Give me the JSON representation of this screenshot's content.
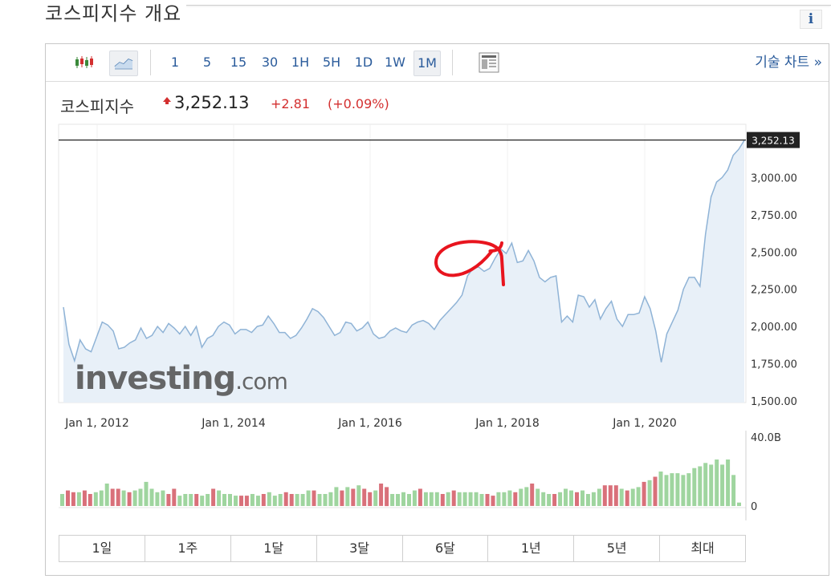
{
  "page": {
    "section_title": "코스피지수 개요",
    "info_icon_label": "i"
  },
  "toolbar": {
    "chart_types": [
      {
        "name": "candlestick-icon",
        "active": false
      },
      {
        "name": "line-chart-icon",
        "active": true
      }
    ],
    "intervals": [
      "1",
      "5",
      "15",
      "30",
      "1H",
      "5H",
      "1D",
      "1W",
      "1M"
    ],
    "active_interval": "1M",
    "technical_chart_link": "기술 차트 »"
  },
  "quote": {
    "name": "코스피지수",
    "price": "3,252.13",
    "change": "+2.81",
    "change_pct": "(+0.09%)",
    "up_color": "#d32f2f"
  },
  "chart_data": {
    "type": "line",
    "title": "",
    "xlabel": "",
    "ylabel": "",
    "x_tick_labels": [
      "Jan 1, 2012",
      "Jan 1, 2014",
      "Jan 1, 2016",
      "Jan 1, 2018",
      "Jan 1, 2020"
    ],
    "x_range": [
      "2011-06",
      "2021-06"
    ],
    "y_tick_labels": [
      "1,500.00",
      "1,750.00",
      "2,000.00",
      "2,250.00",
      "2,500.00",
      "2,750.00",
      "3,000.00"
    ],
    "ylim": [
      1500,
      3250
    ],
    "last_price_label": "3,252.13",
    "last_price": 3252.13,
    "watermark": "investing.com",
    "series": [
      {
        "values": [
          2130,
          1880,
          1770,
          1910,
          1850,
          1830,
          1930,
          2030,
          2010,
          1970,
          1850,
          1860,
          1890,
          1910,
          1990,
          1920,
          1940,
          2000,
          1960,
          2020,
          1990,
          1950,
          2000,
          1940,
          2000,
          1860,
          1920,
          1940,
          2000,
          2030,
          2010,
          1950,
          1980,
          1980,
          1960,
          2000,
          2010,
          2070,
          2020,
          1960,
          1960,
          1920,
          1940,
          1990,
          2050,
          2120,
          2100,
          2060,
          2000,
          1940,
          1960,
          2030,
          2020,
          1970,
          1990,
          2030,
          1950,
          1920,
          1930,
          1970,
          1990,
          1970,
          1960,
          2010,
          2030,
          2040,
          2020,
          1980,
          2040,
          2080,
          2120,
          2160,
          2210,
          2340,
          2390,
          2400,
          2370,
          2390,
          2460,
          2520,
          2490,
          2560,
          2430,
          2440,
          2510,
          2440,
          2330,
          2300,
          2330,
          2340,
          2030,
          2070,
          2030,
          2210,
          2200,
          2130,
          2180,
          2050,
          2120,
          2170,
          2050,
          2000,
          2080,
          2080,
          2090,
          2200,
          2120,
          1970,
          1760,
          1950,
          2030,
          2110,
          2250,
          2330,
          2330,
          2270,
          2620,
          2870,
          2970,
          3000,
          3050,
          3150,
          3190,
          3250
        ]
      }
    ],
    "volume_axis_labels": [
      "40.0B",
      "0"
    ],
    "volume": [
      {
        "v": 7,
        "dir": "up"
      },
      {
        "v": 9,
        "dir": "down"
      },
      {
        "v": 8,
        "dir": "down"
      },
      {
        "v": 8,
        "dir": "up"
      },
      {
        "v": 9,
        "dir": "down"
      },
      {
        "v": 7,
        "dir": "down"
      },
      {
        "v": 8,
        "dir": "up"
      },
      {
        "v": 9,
        "dir": "up"
      },
      {
        "v": 13,
        "dir": "up"
      },
      {
        "v": 10,
        "dir": "down"
      },
      {
        "v": 10,
        "dir": "down"
      },
      {
        "v": 9,
        "dir": "up"
      },
      {
        "v": 8,
        "dir": "down"
      },
      {
        "v": 9,
        "dir": "up"
      },
      {
        "v": 10,
        "dir": "up"
      },
      {
        "v": 14,
        "dir": "up"
      },
      {
        "v": 10,
        "dir": "up"
      },
      {
        "v": 8,
        "dir": "up"
      },
      {
        "v": 9,
        "dir": "up"
      },
      {
        "v": 7,
        "dir": "down"
      },
      {
        "v": 10,
        "dir": "down"
      },
      {
        "v": 6,
        "dir": "up"
      },
      {
        "v": 7,
        "dir": "up"
      },
      {
        "v": 7,
        "dir": "up"
      },
      {
        "v": 7,
        "dir": "down"
      },
      {
        "v": 6,
        "dir": "up"
      },
      {
        "v": 7,
        "dir": "up"
      },
      {
        "v": 10,
        "dir": "down"
      },
      {
        "v": 9,
        "dir": "up"
      },
      {
        "v": 7,
        "dir": "up"
      },
      {
        "v": 7,
        "dir": "up"
      },
      {
        "v": 6,
        "dir": "up"
      },
      {
        "v": 6,
        "dir": "down"
      },
      {
        "v": 6,
        "dir": "down"
      },
      {
        "v": 7,
        "dir": "up"
      },
      {
        "v": 6,
        "dir": "up"
      },
      {
        "v": 7,
        "dir": "down"
      },
      {
        "v": 8,
        "dir": "up"
      },
      {
        "v": 6,
        "dir": "up"
      },
      {
        "v": 7,
        "dir": "up"
      },
      {
        "v": 8,
        "dir": "down"
      },
      {
        "v": 7,
        "dir": "down"
      },
      {
        "v": 7,
        "dir": "up"
      },
      {
        "v": 7,
        "dir": "up"
      },
      {
        "v": 9,
        "dir": "up"
      },
      {
        "v": 9,
        "dir": "down"
      },
      {
        "v": 7,
        "dir": "up"
      },
      {
        "v": 7,
        "dir": "up"
      },
      {
        "v": 8,
        "dir": "up"
      },
      {
        "v": 11,
        "dir": "up"
      },
      {
        "v": 9,
        "dir": "down"
      },
      {
        "v": 11,
        "dir": "up"
      },
      {
        "v": 10,
        "dir": "down"
      },
      {
        "v": 12,
        "dir": "up"
      },
      {
        "v": 10,
        "dir": "down"
      },
      {
        "v": 8,
        "dir": "down"
      },
      {
        "v": 9,
        "dir": "up"
      },
      {
        "v": 13,
        "dir": "down"
      },
      {
        "v": 11,
        "dir": "down"
      },
      {
        "v": 7,
        "dir": "up"
      },
      {
        "v": 7,
        "dir": "up"
      },
      {
        "v": 8,
        "dir": "up"
      },
      {
        "v": 7,
        "dir": "up"
      },
      {
        "v": 9,
        "dir": "up"
      },
      {
        "v": 10,
        "dir": "down"
      },
      {
        "v": 8,
        "dir": "up"
      },
      {
        "v": 8,
        "dir": "up"
      },
      {
        "v": 8,
        "dir": "up"
      },
      {
        "v": 7,
        "dir": "down"
      },
      {
        "v": 8,
        "dir": "up"
      },
      {
        "v": 9,
        "dir": "down"
      },
      {
        "v": 8,
        "dir": "up"
      },
      {
        "v": 8,
        "dir": "up"
      },
      {
        "v": 8,
        "dir": "up"
      },
      {
        "v": 8,
        "dir": "up"
      },
      {
        "v": 7,
        "dir": "up"
      },
      {
        "v": 7,
        "dir": "down"
      },
      {
        "v": 6,
        "dir": "down"
      },
      {
        "v": 8,
        "dir": "up"
      },
      {
        "v": 8,
        "dir": "up"
      },
      {
        "v": 9,
        "dir": "up"
      },
      {
        "v": 8,
        "dir": "down"
      },
      {
        "v": 10,
        "dir": "up"
      },
      {
        "v": 11,
        "dir": "up"
      },
      {
        "v": 13,
        "dir": "down"
      },
      {
        "v": 10,
        "dir": "up"
      },
      {
        "v": 8,
        "dir": "up"
      },
      {
        "v": 7,
        "dir": "up"
      },
      {
        "v": 7,
        "dir": "down"
      },
      {
        "v": 8,
        "dir": "up"
      },
      {
        "v": 10,
        "dir": "up"
      },
      {
        "v": 9,
        "dir": "up"
      },
      {
        "v": 8,
        "dir": "down"
      },
      {
        "v": 9,
        "dir": "up"
      },
      {
        "v": 7,
        "dir": "up"
      },
      {
        "v": 8,
        "dir": "up"
      },
      {
        "v": 10,
        "dir": "up"
      },
      {
        "v": 12,
        "dir": "down"
      },
      {
        "v": 12,
        "dir": "down"
      },
      {
        "v": 12,
        "dir": "down"
      },
      {
        "v": 10,
        "dir": "up"
      },
      {
        "v": 9,
        "dir": "down"
      },
      {
        "v": 10,
        "dir": "up"
      },
      {
        "v": 11,
        "dir": "up"
      },
      {
        "v": 14,
        "dir": "down"
      },
      {
        "v": 15,
        "dir": "up"
      },
      {
        "v": 17,
        "dir": "down"
      },
      {
        "v": 20,
        "dir": "up"
      },
      {
        "v": 18,
        "dir": "up"
      },
      {
        "v": 19,
        "dir": "up"
      },
      {
        "v": 19,
        "dir": "up"
      },
      {
        "v": 18,
        "dir": "up"
      },
      {
        "v": 19,
        "dir": "up"
      },
      {
        "v": 22,
        "dir": "up"
      },
      {
        "v": 23,
        "dir": "up"
      },
      {
        "v": 25,
        "dir": "up"
      },
      {
        "v": 24,
        "dir": "up"
      },
      {
        "v": 27,
        "dir": "up"
      },
      {
        "v": 24,
        "dir": "up"
      },
      {
        "v": 27,
        "dir": "up"
      },
      {
        "v": 18,
        "dir": "up"
      },
      {
        "v": 2,
        "dir": "up"
      }
    ],
    "colors": {
      "line": "#8fb3d6",
      "area": "#e8f0f8",
      "volume_up": "#9fd59f",
      "volume_down": "#d9707a",
      "price_line": "#222222",
      "annotation": "#e8141e"
    }
  },
  "range_buttons": [
    "1일",
    "1주",
    "1달",
    "3달",
    "6달",
    "1년",
    "5년",
    "최대"
  ]
}
